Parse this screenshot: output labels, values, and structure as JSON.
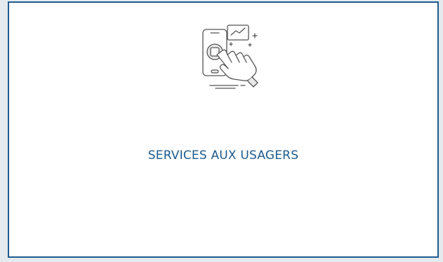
{
  "card": {
    "title": "SERVICES AUX USAGERS",
    "icon": "touch-phone-icon"
  },
  "colors": {
    "border": "#1f5a8c",
    "title": "#1e5a8c",
    "icon_stroke": "#555555",
    "icon_fill": "#e9e9e9"
  }
}
